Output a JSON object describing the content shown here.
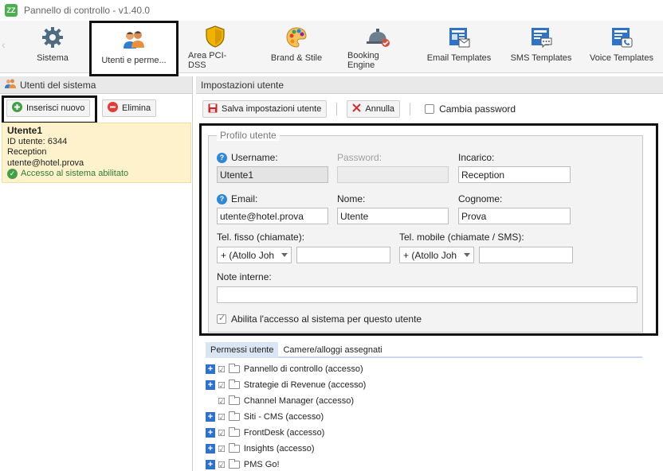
{
  "window": {
    "title": "Pannello di controllo - v1.40.0",
    "logo_text": "ZZ"
  },
  "toolbar": {
    "scroll_left": "‹",
    "items": [
      {
        "label": "Sistema",
        "icon": "gear-icon"
      },
      {
        "label": "Utenti e perme...",
        "icon": "users-icon"
      },
      {
        "label": "Area PCI-DSS",
        "icon": "shield-icon"
      },
      {
        "label": "Brand & Stile",
        "icon": "palette-icon"
      },
      {
        "label": "Booking Engine",
        "icon": "reception-bell-icon"
      },
      {
        "label": "Email Templates",
        "icon": "email-template-icon"
      },
      {
        "label": "SMS Templates",
        "icon": "sms-template-icon"
      },
      {
        "label": "Voice Templates",
        "icon": "voice-template-icon"
      }
    ]
  },
  "left": {
    "header": "Utenti del sistema",
    "add_button": "Inserisci nuovo",
    "delete_button": "Elimina",
    "user": {
      "name": "Utente1",
      "id": "ID utente: 6344",
      "role": "Reception",
      "email": "utente@hotel.prova",
      "status": "Accesso al sistema abilitato"
    }
  },
  "right": {
    "header": "Impostazioni utente",
    "save_button": "Salva impostazioni utente",
    "cancel_button": "Annulla",
    "change_password": "Cambia password",
    "profile": {
      "legend": "Profilo utente",
      "username_label": "Username:",
      "username_value": "Utente1",
      "password_label": "Password:",
      "incarico_label": "Incarico:",
      "incarico_value": "Reception",
      "email_label": "Email:",
      "email_value": "utente@hotel.prova",
      "nome_label": "Nome:",
      "nome_value": "Utente",
      "cognome_label": "Cognome:",
      "cognome_value": "Prova",
      "tel_fisso_label": "Tel. fisso (chiamate):",
      "tel_mobile_label": "Tel. mobile (chiamate / SMS):",
      "prefix_value": "+ (Atollo Joh",
      "note_label": "Note interne:",
      "enable_label": "Abilita l'accesso al sistema per questo utente"
    },
    "tabs": [
      "Permessi utente",
      "Camere/alloggi assegnati"
    ],
    "permissions": [
      {
        "label": "Pannello di controllo (accesso)",
        "expandable": true
      },
      {
        "label": "Strategie di Revenue (accesso)",
        "expandable": true
      },
      {
        "label": "Channel Manager (accesso)",
        "expandable": false
      },
      {
        "label": "Siti - CMS (accesso)",
        "expandable": true
      },
      {
        "label": "FrontDesk (accesso)",
        "expandable": true
      },
      {
        "label": "Insights (accesso)",
        "expandable": true
      },
      {
        "label": "PMS Go!",
        "expandable": true
      }
    ]
  }
}
